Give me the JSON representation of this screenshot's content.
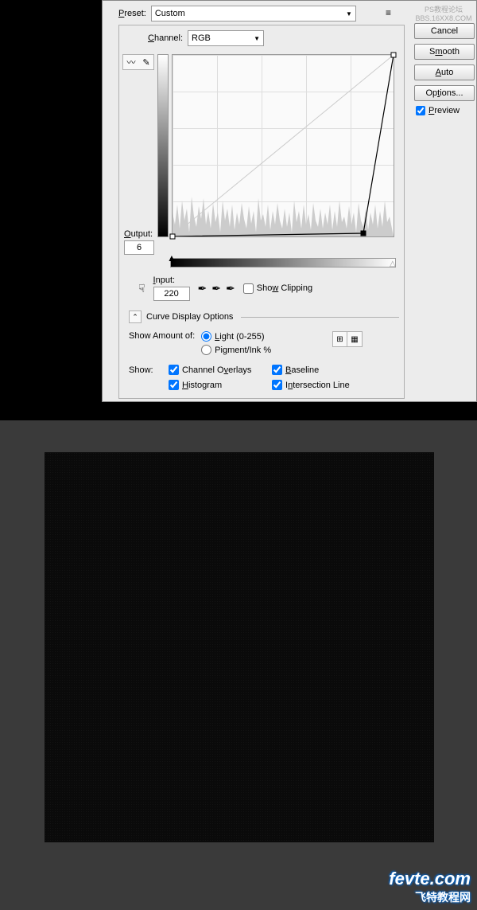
{
  "preset": {
    "label": "Preset:",
    "value": "Custom"
  },
  "channel": {
    "label": "Channel:",
    "value": "RGB",
    "underline": "C"
  },
  "output": {
    "label": "Output:",
    "value": "6",
    "underline": "O"
  },
  "input": {
    "label": "Input:",
    "value": "220",
    "underline": "I"
  },
  "show_clipping": {
    "label": "Show Clipping",
    "underline": "W"
  },
  "curve_display": "Curve Display Options",
  "show_amount": {
    "label": "Show Amount of:",
    "light": {
      "label": "Light  (0-255)",
      "underline": "L"
    },
    "pigment": {
      "label": "Pigment/Ink %",
      "underline": "G"
    }
  },
  "show_section": {
    "label": "Show:",
    "overlays": {
      "label": "Channel Overlays",
      "underline": "V"
    },
    "baseline": {
      "label": "Baseline",
      "underline": "B"
    },
    "histogram": {
      "label": "Histogram",
      "underline": "H"
    },
    "intersection": {
      "label": "Intersection Line",
      "underline": "N"
    }
  },
  "buttons": {
    "cancel": "Cancel",
    "smooth": "Smooth",
    "auto": {
      "label": "Auto",
      "underline": "A"
    },
    "options": "Options..."
  },
  "preview": {
    "label": "Preview",
    "underline": "P"
  },
  "top_watermark": {
    "line1": "PS教程论坛",
    "line2": "BBS.16XX8.COM"
  },
  "watermark": {
    "line1": "fevte.com",
    "line2": "飞特教程网"
  },
  "chart_data": {
    "type": "curve",
    "channel": "RGB",
    "input_range": [
      0,
      255
    ],
    "output_range": [
      0,
      255
    ],
    "points": [
      {
        "input": 0,
        "output": 0
      },
      {
        "input": 220,
        "output": 6
      },
      {
        "input": 255,
        "output": 255
      }
    ],
    "output_value": 6,
    "input_value": 220
  }
}
